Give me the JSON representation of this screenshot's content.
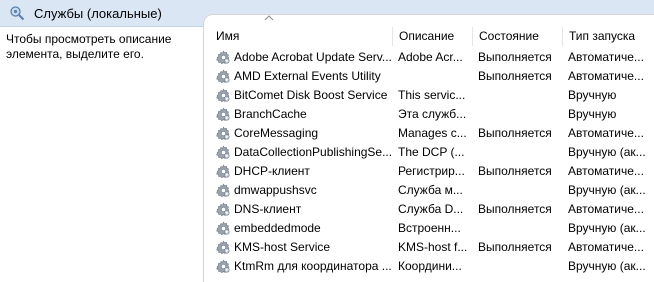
{
  "window": {
    "title": "Службы (локальные)",
    "icon": "magnifier-gear-icon"
  },
  "left_pane": {
    "description": "Чтобы просмотреть описание элемента, выделите его."
  },
  "columns": {
    "name": "Имя",
    "description": "Описание",
    "state": "Состояние",
    "startup_type": "Тип запуска",
    "sorted_by": "name",
    "sort_icon": "sort-ascending-icon"
  },
  "services": [
    {
      "name": "Adobe Acrobat Update Serv...",
      "description": "Adobe Acr...",
      "state": "Выполняется",
      "startup_type": "Автоматиче..."
    },
    {
      "name": "AMD External Events Utility",
      "description": "",
      "state": "Выполняется",
      "startup_type": "Автоматиче..."
    },
    {
      "name": "BitComet Disk Boost Service",
      "description": "This servic...",
      "state": "",
      "startup_type": "Вручную"
    },
    {
      "name": "BranchCache",
      "description": "Эта служб...",
      "state": "",
      "startup_type": "Вручную"
    },
    {
      "name": "CoreMessaging",
      "description": "Manages c...",
      "state": "Выполняется",
      "startup_type": "Автоматиче..."
    },
    {
      "name": "DataCollectionPublishingSe...",
      "description": "The DCP (...",
      "state": "",
      "startup_type": "Вручную (ак..."
    },
    {
      "name": "DHCP-клиент",
      "description": "Регистрир...",
      "state": "Выполняется",
      "startup_type": "Автоматиче..."
    },
    {
      "name": "dmwappushsvc",
      "description": "Служба м...",
      "state": "",
      "startup_type": "Вручную (ак..."
    },
    {
      "name": "DNS-клиент",
      "description": "Служба D...",
      "state": "Выполняется",
      "startup_type": "Автоматиче..."
    },
    {
      "name": "embeddedmode",
      "description": "Встроенн...",
      "state": "",
      "startup_type": "Вручную (ак..."
    },
    {
      "name": "KMS-host Service",
      "description": "KMS-host f...",
      "state": "Выполняется",
      "startup_type": "Автоматиче..."
    },
    {
      "name": "KtmRm для координатора ...",
      "description": "Координи...",
      "state": "",
      "startup_type": "Вручную (ак..."
    }
  ],
  "service_icon": "service-gear-icon",
  "colors": {
    "title_bar": "#dbe6f4",
    "background": "#ffffff"
  }
}
